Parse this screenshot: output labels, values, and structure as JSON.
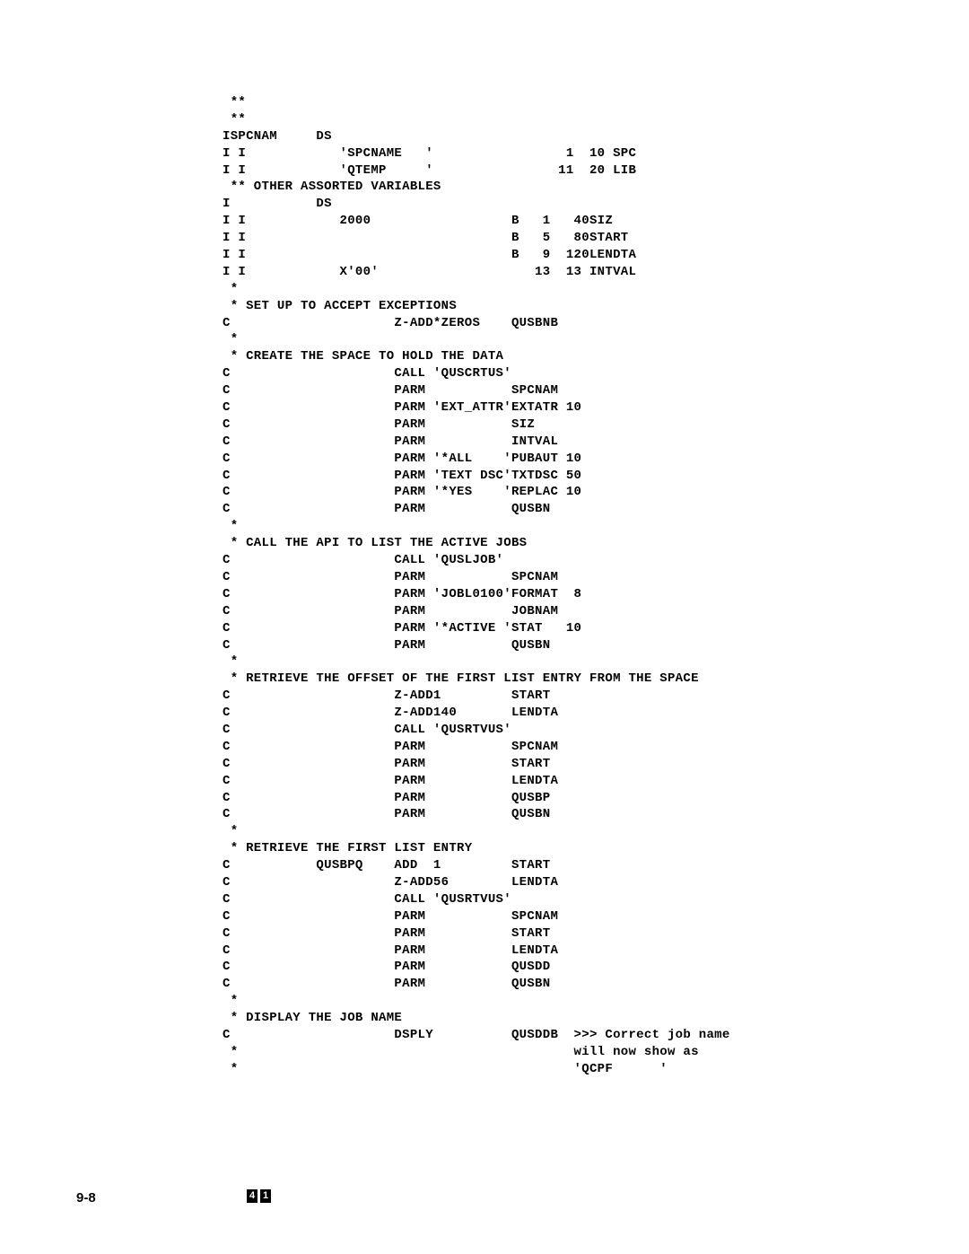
{
  "code": " **\n **\nISPCNAM     DS\nI I            'SPCNAME   '                 1  10 SPC\nI I            'QTEMP     '                11  20 LIB\n ** OTHER ASSORTED VARIABLES\nI           DS\nI I            2000                  B   1   40SIZ\nI I                                  B   5   80START\nI I                                  B   9  120LENDTA\nI I            X'00'                    13  13 INTVAL\n *\n * SET UP TO ACCEPT EXCEPTIONS\nC                     Z-ADD*ZEROS    QUSBNB\n *\n * CREATE THE SPACE TO HOLD THE DATA\nC                     CALL 'QUSCRTUS'\nC                     PARM           SPCNAM\nC                     PARM 'EXT_ATTR'EXTATR 10\nC                     PARM           SIZ\nC                     PARM           INTVAL\nC                     PARM '*ALL    'PUBAUT 10\nC                     PARM 'TEXT DSC'TXTDSC 50\nC                     PARM '*YES    'REPLAC 10\nC                     PARM           QUSBN\n *\n * CALL THE API TO LIST THE ACTIVE JOBS\nC                     CALL 'QUSLJOB'\nC                     PARM           SPCNAM\nC                     PARM 'JOBL0100'FORMAT  8\nC                     PARM           JOBNAM\nC                     PARM '*ACTIVE 'STAT   10\nC                     PARM           QUSBN\n *\n * RETRIEVE THE OFFSET OF THE FIRST LIST ENTRY FROM THE SPACE\nC                     Z-ADD1         START\nC                     Z-ADD140       LENDTA\nC                     CALL 'QUSRTVUS'\nC                     PARM           SPCNAM\nC                     PARM           START\nC                     PARM           LENDTA\nC                     PARM           QUSBP\nC                     PARM           QUSBN\n *\n * RETRIEVE THE FIRST LIST ENTRY\nC           QUSBPQ    ADD  1         START\nC                     Z-ADD56        LENDTA\nC                     CALL 'QUSRTVUS'\nC                     PARM           SPCNAM\nC                     PARM           START\nC                     PARM           LENDTA\nC                     PARM           QUSDD\nC                     PARM           QUSBN\n *\n * DISPLAY THE JOB NAME\nC                     DSPLY          QUSDDB  >>> Correct job name\n *                                           will now show as\n *                                           'QCPF      '",
  "page_number": "9-8",
  "footer_digit_1": "4",
  "footer_digit_2": "1"
}
